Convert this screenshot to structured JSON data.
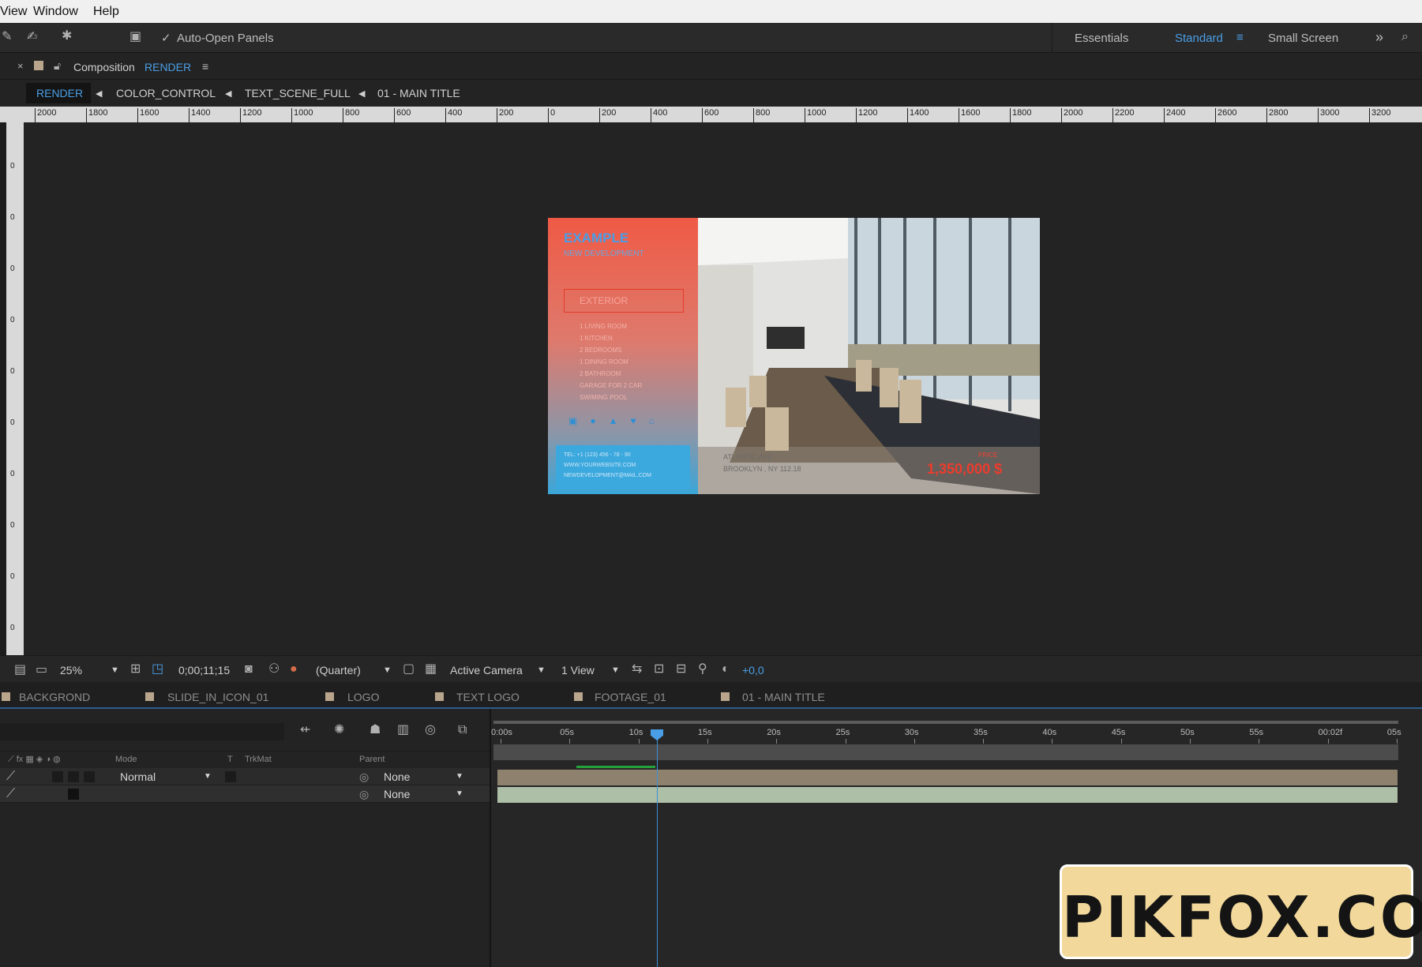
{
  "menubar": {
    "items": [
      "View",
      "Window",
      "Help"
    ]
  },
  "toolbar": {
    "auto_open_label": "Auto-Open Panels",
    "workspaces": [
      "Essentials",
      "Standard",
      "Small Screen"
    ],
    "active_workspace": "Standard"
  },
  "composition": {
    "prefix": "Composition",
    "name": "RENDER"
  },
  "breadcrumbs": [
    "RENDER",
    "COLOR_CONTROL",
    "TEXT_SCENE_FULL",
    "01 - MAIN TITLE"
  ],
  "rulers": {
    "top": [
      "2000",
      "1800",
      "1600",
      "1400",
      "1200",
      "1000",
      "800",
      "600",
      "400",
      "200",
      "0",
      "200",
      "400",
      "600",
      "800",
      "1000",
      "1200",
      "1400",
      "1600",
      "1800",
      "2000",
      "2200",
      "2400",
      "2600",
      "2800",
      "3000",
      "3200"
    ],
    "left": [
      "0",
      "0",
      "0",
      "0",
      "0",
      "0",
      "0",
      "0",
      "0",
      "0"
    ]
  },
  "preview": {
    "title": "EXAMPLE",
    "subtitle": "NEW DEVELOPMENT",
    "section_label": "EXTERIOR",
    "features": [
      "1 LIVING ROOM",
      "1 KITCHEN",
      "2 BEDROOMS",
      "1 DINING ROOM",
      "2 BATHROOM",
      "GARAGE FOR 2 CAR",
      "SWIMING POOL"
    ],
    "contact": [
      "TEL: +1 (123) 456 - 78 - 90",
      "WWW.YOURWEBSITE.COM",
      "NEWDEVELOPMENT@MAIL.COM"
    ],
    "address_line1": "ATLANTIC AVE",
    "address_line2": "BROOKLYN , NY 112.18",
    "price_label": "PRICE",
    "price": "1,350,000 $"
  },
  "viewer_controls": {
    "zoom": "25%",
    "timecode": "0;00;11;15",
    "resolution": "(Quarter)",
    "camera": "Active Camera",
    "views": "1 View",
    "exposure": "+0,0"
  },
  "timeline_tabs": [
    "BACKGROND",
    "SLIDE_IN_ICON_01",
    "LOGO",
    "TEXT LOGO",
    "FOOTAGE_01",
    "01 - MAIN TITLE"
  ],
  "timeline": {
    "columns": {
      "mode": "Mode",
      "t": "T",
      "trkmat": "TrkMat",
      "parent": "Parent"
    },
    "time_ticks": [
      "0:00s",
      "05s",
      "10s",
      "15s",
      "20s",
      "25s",
      "30s",
      "35s",
      "40s",
      "45s",
      "50s",
      "55s",
      "00:02f",
      "05s"
    ],
    "layers": [
      {
        "mode": "Normal",
        "parent": "None"
      },
      {
        "mode": "",
        "parent": "None"
      }
    ],
    "playhead_seconds": 11.5
  },
  "watermark": "PIKFOX.COM"
}
